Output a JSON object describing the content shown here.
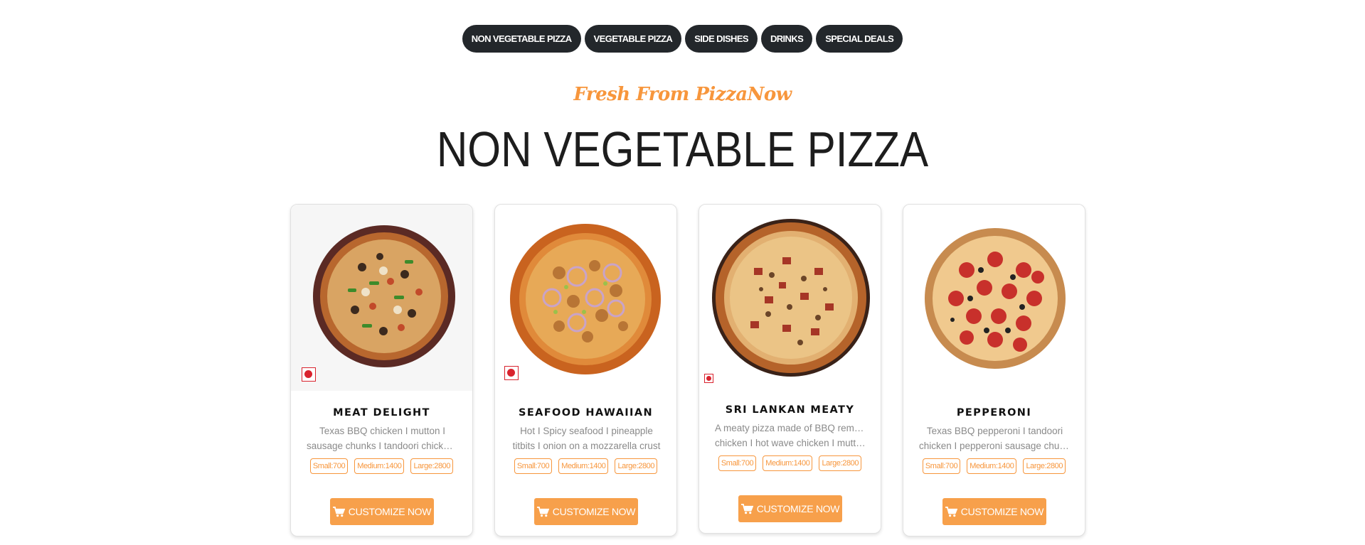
{
  "nav": {
    "tabs": [
      {
        "label": "NON VEGETABLE PIZZA"
      },
      {
        "label": "VEGETABLE PIZZA"
      },
      {
        "label": "SIDE DISHES"
      },
      {
        "label": "DRINKS"
      },
      {
        "label": "SPECIAL DEALS"
      }
    ]
  },
  "section": {
    "subtitle": "Fresh From PizzaNow",
    "title": "NON VEGETABLE PIZZA"
  },
  "products": [
    {
      "name": "MEAT DELIGHT",
      "desc_line1": "Texas BBQ chicken I mutton I",
      "desc_line2": "sausage chunks I tandoori chicken ...",
      "sizes": [
        "Small:700",
        "Medium:1400",
        "Large:2800"
      ],
      "button": "CUSTOMIZE NOW"
    },
    {
      "name": "SEAFOOD HAWAIIAN",
      "desc_line1": "Hot I Spicy seafood I pineapple",
      "desc_line2": "titbits I onion on a mozzarella crust",
      "sizes": [
        "Small:700",
        "Medium:1400",
        "Large:2800"
      ],
      "button": "CUSTOMIZE NOW"
    },
    {
      "name": "SRI LANKAN MEATY",
      "desc_line1": "A meaty pizza made of BBQ remedy",
      "desc_line2": "chicken I hot wave chicken I mutto...",
      "sizes": [
        "Small:700",
        "Medium:1400",
        "Large:2800"
      ],
      "button": "CUSTOMIZE NOW"
    },
    {
      "name": "PEPPERONI",
      "desc_line1": "Texas BBQ pepperoni I tandoori",
      "desc_line2": "chicken I pepperoni sausage chunk...",
      "sizes": [
        "Small:700",
        "Medium:1400",
        "Large:2800"
      ],
      "button": "CUSTOMIZE NOW"
    }
  ],
  "colors": {
    "accent": "#f7963c",
    "button": "#f7a04b",
    "tab_bg": "#23272b",
    "non_veg_mark": "#d9232e"
  },
  "icons": {
    "cart": "shopping-cart-icon",
    "non_veg": "non-veg-mark-icon"
  }
}
